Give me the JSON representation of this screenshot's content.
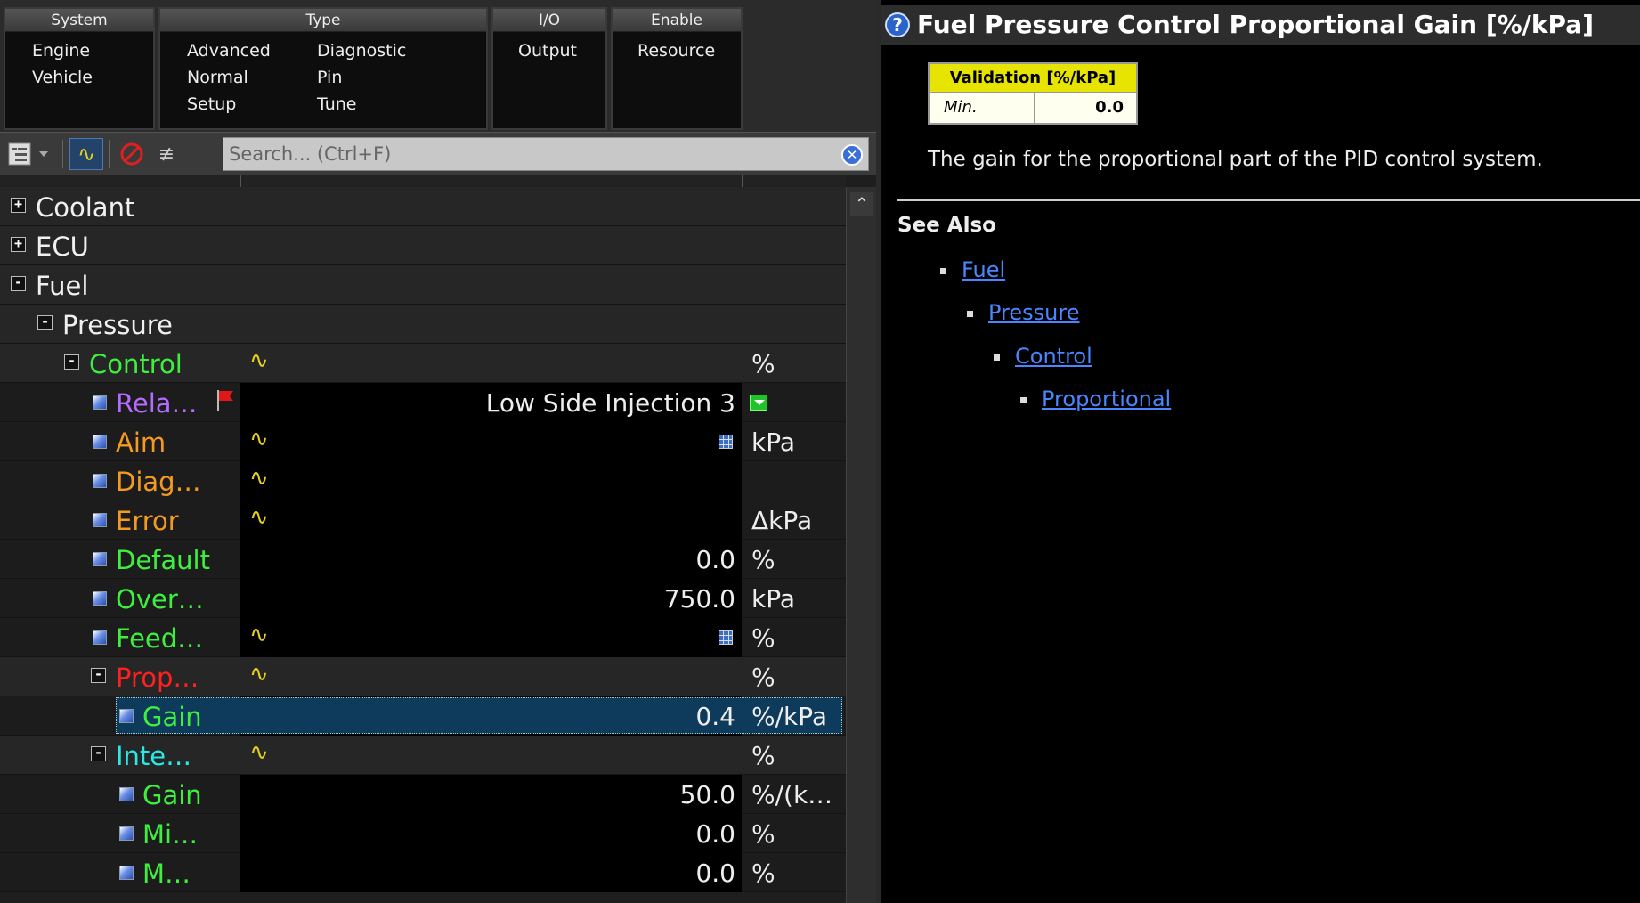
{
  "filters": {
    "groups": [
      {
        "title": "System",
        "items": [
          "Engine",
          "Vehicle"
        ]
      },
      {
        "title": "Type",
        "items": [
          "Advanced",
          "Normal",
          "Setup",
          "Diagnostic",
          "Pin",
          "Tune"
        ]
      },
      {
        "title": "I/O",
        "items": [
          "Output"
        ]
      },
      {
        "title": "Enable",
        "items": [
          "Resource"
        ]
      }
    ]
  },
  "search": {
    "placeholder": "Search... (Ctrl+F)"
  },
  "tree": {
    "rows": [
      {
        "label": "Coolant",
        "kind": "group",
        "level": 0,
        "toggle": "+",
        "color": "#f0f0f0"
      },
      {
        "label": "ECU",
        "kind": "group",
        "level": 0,
        "toggle": "+",
        "color": "#f0f0f0"
      },
      {
        "label": "Fuel",
        "kind": "group",
        "level": 0,
        "toggle": "-",
        "color": "#f0f0f0"
      },
      {
        "label": "Pressure",
        "kind": "group",
        "level": 1,
        "toggle": "-",
        "color": "#f0f0f0"
      },
      {
        "label": "Control",
        "kind": "group",
        "level": 2,
        "toggle": "-",
        "color": "#3ef03e",
        "wave": true,
        "unit": "%"
      },
      {
        "label": "Rela…",
        "kind": "leaf",
        "level": 3,
        "color": "#b56bff",
        "flag": true,
        "value": "Low Side Injection 3",
        "dropdown": true
      },
      {
        "label": "Aim",
        "kind": "leaf",
        "level": 3,
        "color": "#f29a22",
        "wave": true,
        "grid": true,
        "unit": "kPa"
      },
      {
        "label": "Diag…",
        "kind": "leaf",
        "level": 3,
        "color": "#f29a22",
        "wave": true
      },
      {
        "label": "Error",
        "kind": "leaf",
        "level": 3,
        "color": "#f29a22",
        "wave": true,
        "unit": "ΔkPa"
      },
      {
        "label": "Default",
        "kind": "leaf",
        "level": 3,
        "color": "#3ef03e",
        "value": "0.0",
        "unit": "%"
      },
      {
        "label": "Over…",
        "kind": "leaf",
        "level": 3,
        "color": "#3ef03e",
        "value": "750.0",
        "unit": "kPa"
      },
      {
        "label": "Feed…",
        "kind": "leaf",
        "level": 3,
        "color": "#3ef03e",
        "wave": true,
        "grid": true,
        "unit": "%"
      },
      {
        "label": "Prop…",
        "kind": "group",
        "level": 3,
        "toggle": "-",
        "color": "#ff2020",
        "wave": true,
        "unit": "%"
      },
      {
        "label": "Gain",
        "kind": "selected",
        "level": 4,
        "color": "#3ef03e",
        "value": "0.4",
        "unit": "%/kPa"
      },
      {
        "label": "Inte…",
        "kind": "group",
        "level": 3,
        "toggle": "-",
        "color": "#28e8e8",
        "wave": true,
        "unit": "%"
      },
      {
        "label": "Gain",
        "kind": "leaf",
        "level": 4,
        "color": "#3ef03e",
        "value": "50.0",
        "unit": "%/(k…"
      },
      {
        "label": "Mi…",
        "kind": "leaf",
        "level": 4,
        "color": "#3ef03e",
        "value": "0.0",
        "unit": "%"
      },
      {
        "label": "M…",
        "kind": "leaf",
        "level": 4,
        "color": "#3ef03e",
        "value": "0.0",
        "unit": "%"
      }
    ]
  },
  "help": {
    "title": "Fuel Pressure Control Proportional Gain [%/kPa]",
    "validation": {
      "header": "Validation [%/kPa]",
      "key": "Min.",
      "value": "0.0"
    },
    "description": "The gain for the proportional part of the PID control system.",
    "see_also_label": "See Also",
    "links": [
      "Fuel",
      "Pressure",
      "Control",
      "Proportional"
    ]
  },
  "colors": {
    "link": "#4a86ff",
    "validation_header": "#e6e400",
    "selected_row": "#0e3a5c"
  }
}
